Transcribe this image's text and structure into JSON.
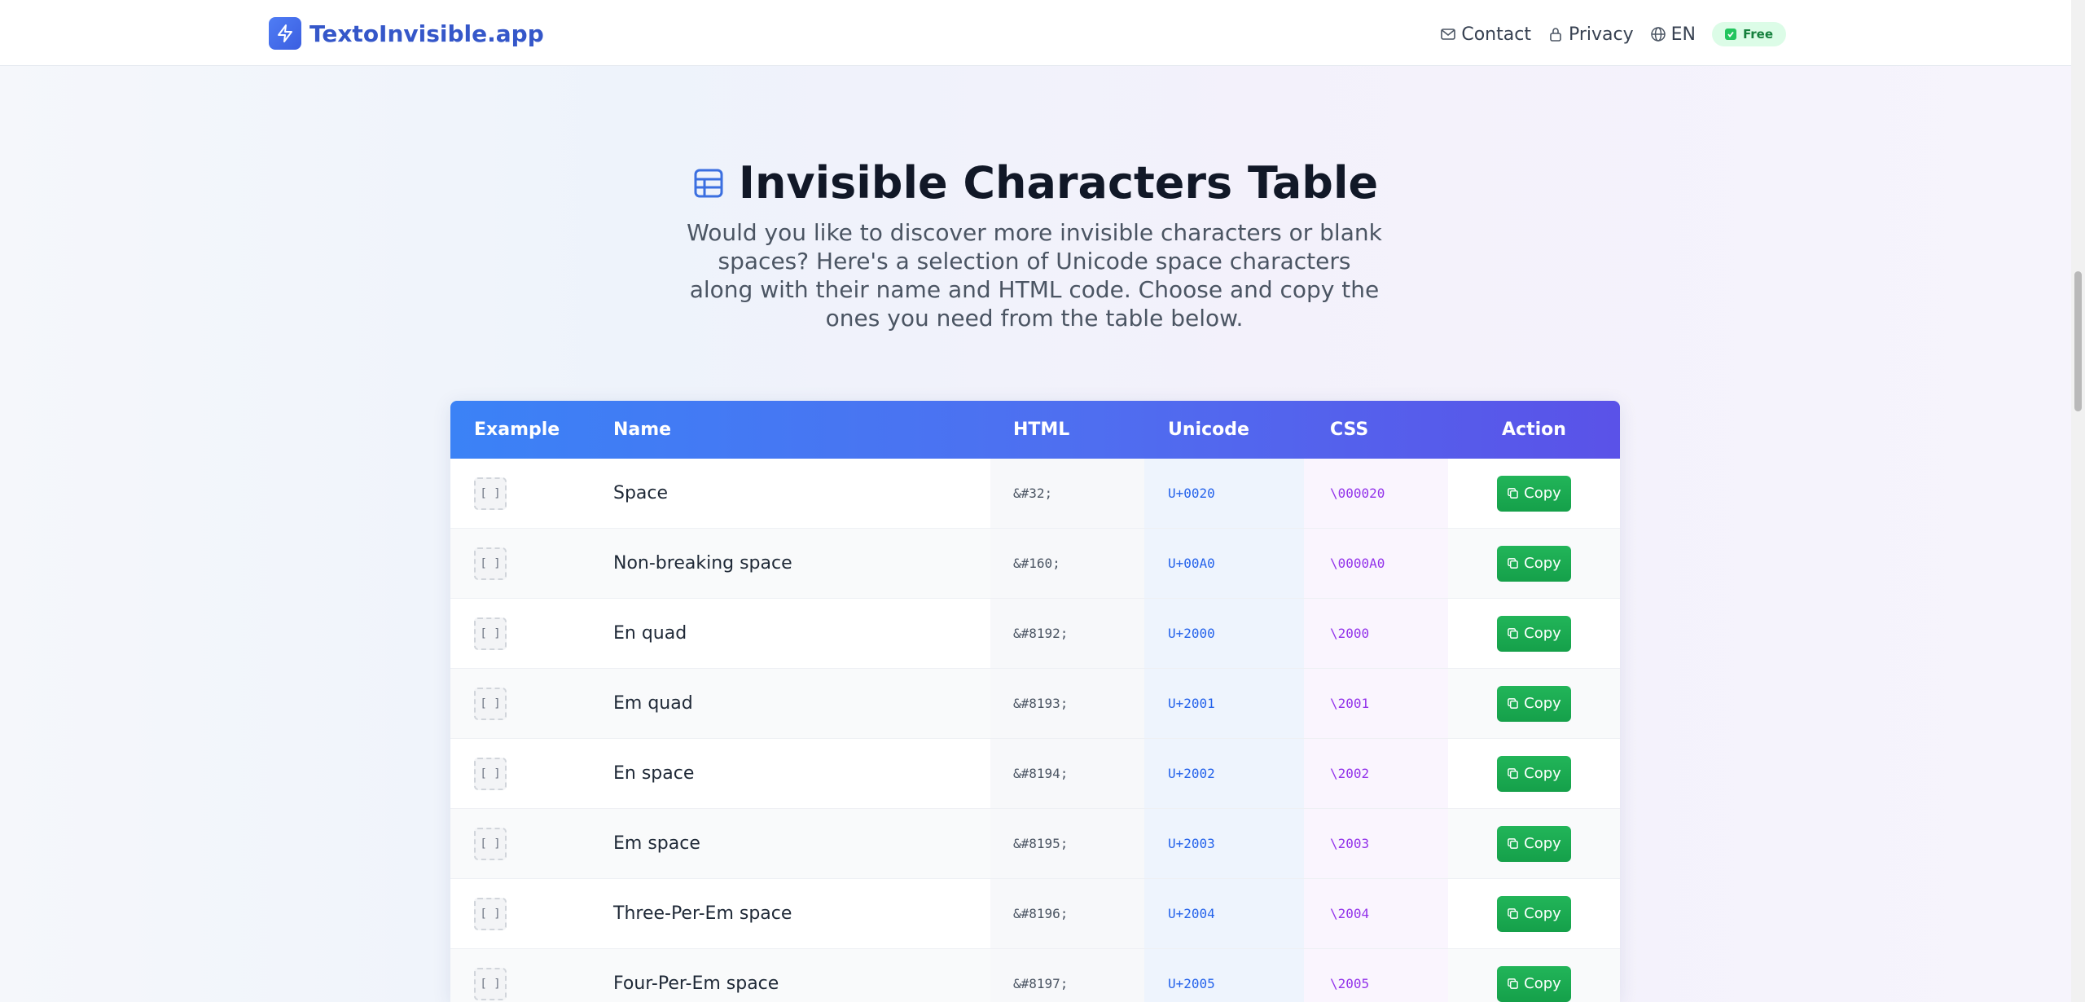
{
  "brand": {
    "name": "TextoInvisible.app",
    "icon": "lightning-icon"
  },
  "nav": {
    "contact": "Contact",
    "privacy": "Privacy",
    "language": "EN",
    "badge": "Free"
  },
  "hero": {
    "title": "Invisible Characters Table",
    "intro": "Would you like to discover more invisible characters or blank spaces? Here's a selection of Unicode space characters along with their name and HTML code. Choose and copy the ones you need from the table below."
  },
  "table": {
    "headers": {
      "example": "Example",
      "name": "Name",
      "html": "HTML",
      "unicode": "Unicode",
      "css": "CSS",
      "action": "Action"
    },
    "rows": [
      {
        "example": "[ ]",
        "name": "Space",
        "html": "&#32;",
        "unicode": "U+0020",
        "css": "\\000020",
        "action": "Copy"
      },
      {
        "example": "[ ]",
        "name": "Non-breaking space",
        "html": "&#160;",
        "unicode": "U+00A0",
        "css": "\\0000A0",
        "action": "Copy"
      },
      {
        "example": "[ ]",
        "name": "En quad",
        "html": "&#8192;",
        "unicode": "U+2000",
        "css": "\\2000",
        "action": "Copy"
      },
      {
        "example": "[ ]",
        "name": "Em quad",
        "html": "&#8193;",
        "unicode": "U+2001",
        "css": "\\2001",
        "action": "Copy"
      },
      {
        "example": "[ ]",
        "name": "En space",
        "html": "&#8194;",
        "unicode": "U+2002",
        "css": "\\2002",
        "action": "Copy"
      },
      {
        "example": "[ ]",
        "name": "Em space",
        "html": "&#8195;",
        "unicode": "U+2003",
        "css": "\\2003",
        "action": "Copy"
      },
      {
        "example": "[ ]",
        "name": "Three-Per-Em space",
        "html": "&#8196;",
        "unicode": "U+2004",
        "css": "\\2004",
        "action": "Copy"
      },
      {
        "example": "[ ]",
        "name": "Four-Per-Em space",
        "html": "&#8197;",
        "unicode": "U+2005",
        "css": "\\2005",
        "action": "Copy"
      }
    ]
  },
  "colors": {
    "brand": "#3557c9",
    "header_gradient_start": "#3b82f6",
    "header_gradient_end": "#5a52e8",
    "copy_button": "#16a34a",
    "badge_bg": "#dcfce7"
  }
}
